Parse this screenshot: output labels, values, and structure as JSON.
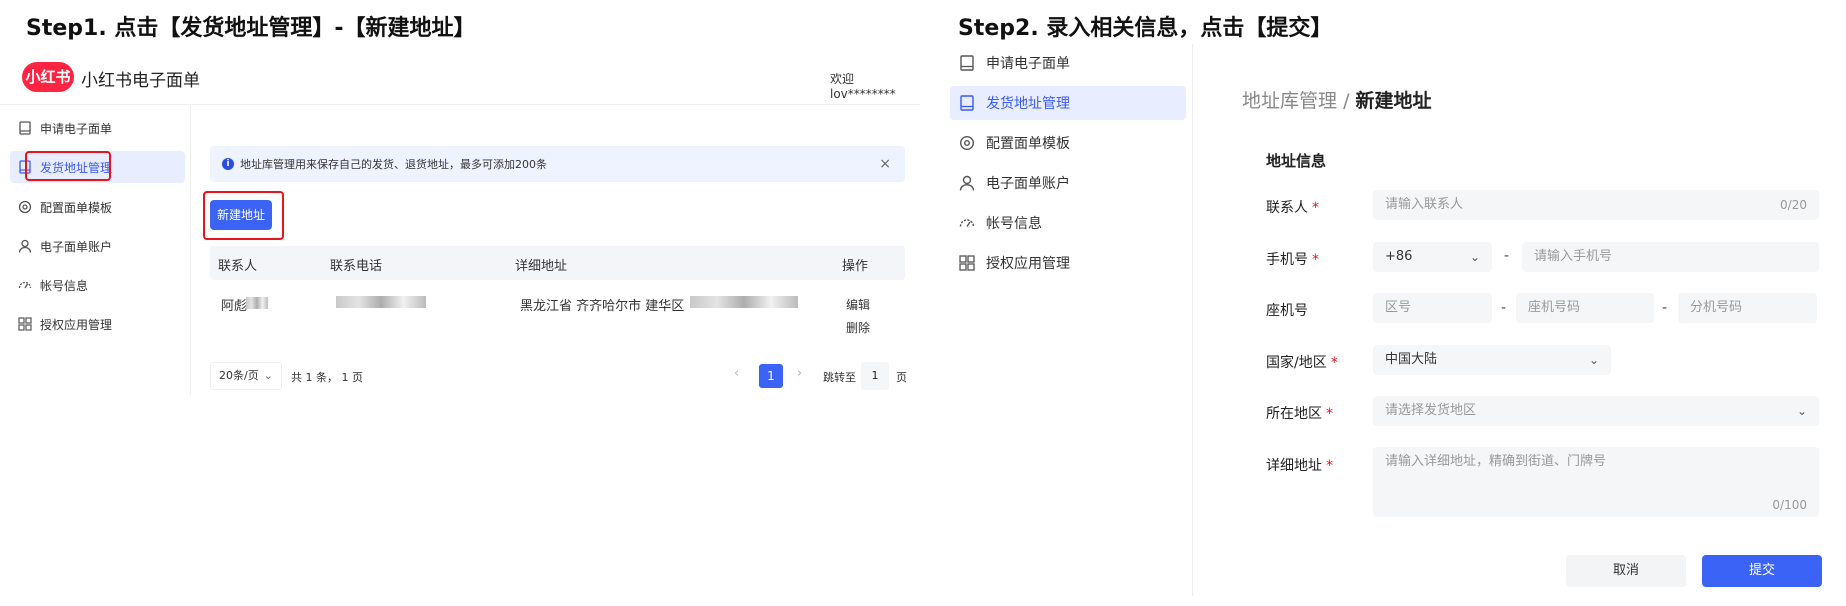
{
  "step1": {
    "title": "Step1. 点击【发货地址管理】-【新建地址】"
  },
  "step2": {
    "title": "Step2. 录入相关信息，点击【提交】"
  },
  "colors": {
    "accent": "#3b63f5",
    "brand": "#ff2442",
    "highlight_box": "#e8141c",
    "active_bg": "#e8edff"
  },
  "left": {
    "logo_text": "小红书",
    "app_name": "小红书电子面单",
    "welcome": "欢迎 lov********",
    "sidebar": [
      {
        "label": "申请电子面单",
        "icon": "book-icon"
      },
      {
        "label": "发货地址管理",
        "icon": "book-icon",
        "active": true
      },
      {
        "label": "配置面单模板",
        "icon": "gear-icon"
      },
      {
        "label": "电子面单账户",
        "icon": "user-icon"
      },
      {
        "label": "帐号信息",
        "icon": "gauge-icon"
      },
      {
        "label": "授权应用管理",
        "icon": "grid-icon"
      }
    ],
    "notice": "地址库管理用来保存自己的发货、退货地址，最多可添加200条",
    "notice_close": "×",
    "new_button": "新建地址",
    "table": {
      "headers": [
        "联系人",
        "联系电话",
        "详细地址",
        "操作"
      ],
      "row": {
        "contact": "阿彪",
        "address": "黑龙江省 齐齐哈尔市 建华区",
        "edit": "编辑",
        "delete": "删除"
      }
    },
    "pager": {
      "page_size": "20条/页",
      "summary": "共 1 条， 1 页",
      "prev": "‹",
      "current": "1",
      "next": "›",
      "jump_label": "跳转至",
      "jump_value": "1",
      "page_unit": "页"
    }
  },
  "right": {
    "sidebar": [
      {
        "label": "申请电子面单",
        "icon": "book-icon"
      },
      {
        "label": "发货地址管理",
        "icon": "book-icon",
        "active": true
      },
      {
        "label": "配置面单模板",
        "icon": "gear-icon"
      },
      {
        "label": "电子面单账户",
        "icon": "user-icon"
      },
      {
        "label": "帐号信息",
        "icon": "gauge-icon"
      },
      {
        "label": "授权应用管理",
        "icon": "grid-icon"
      }
    ],
    "breadcrumb_parent": "地址库管理",
    "breadcrumb_sep": "/",
    "breadcrumb_current": "新建地址",
    "section": "地址信息",
    "fields": {
      "contact_label": "联系人",
      "contact_placeholder": "请输入联系人",
      "contact_count": "0/20",
      "phone_label": "手机号",
      "phone_prefix": "+86",
      "phone_placeholder": "请输入手机号",
      "landline_label": "座机号",
      "area_placeholder": "区号",
      "landline_placeholder": "座机号码",
      "ext_placeholder": "分机号码",
      "country_label": "国家/地区",
      "country_value": "中国大陆",
      "region_label": "所在地区",
      "region_placeholder": "请选择发货地区",
      "detail_label": "详细地址",
      "detail_placeholder": "请输入详细地址，精确到街道、门牌号",
      "detail_count": "0/100",
      "required_mark": "*",
      "dash": "-"
    },
    "cancel_button": "取消",
    "submit_button": "提交"
  }
}
